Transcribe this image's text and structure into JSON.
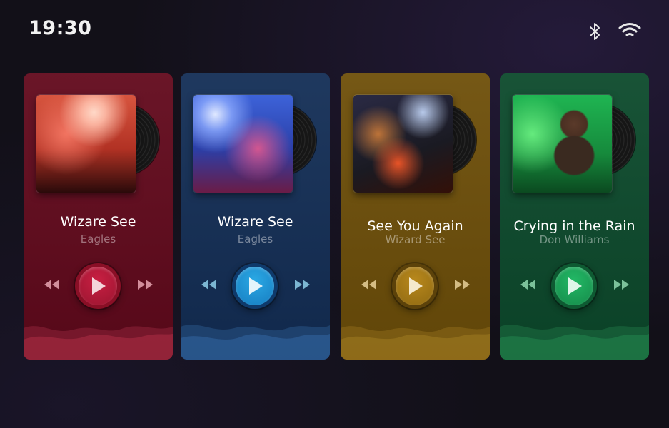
{
  "status": {
    "time": "19:30",
    "bluetooth_icon": "bluetooth-icon",
    "wifi_icon": "wifi-icon"
  },
  "cards": [
    {
      "title": "Wizare See",
      "artist": "Eagles",
      "accent": "#c81f42",
      "cover_icon": "concert-crowd-cover"
    },
    {
      "title": "Wizare See",
      "artist": "Eagles",
      "accent": "#2aa8e4",
      "cover_icon": "party-dancers-cover"
    },
    {
      "title": "See You Again",
      "artist": "Wizard See",
      "accent": "#b8881c",
      "cover_icon": "dj-mixer-cover"
    },
    {
      "title": "Crying in the Rain",
      "artist": "Don Williams",
      "accent": "#22b865",
      "cover_icon": "man-green-light-cover"
    }
  ],
  "controls": {
    "prev_icon": "rewind-icon",
    "play_icon": "play-icon",
    "next_icon": "fast-forward-icon"
  },
  "colors": {
    "red": "#62091c",
    "blue": "#132e56",
    "gold": "#6e4f09",
    "green": "#0c4a2c",
    "background": "#121018"
  }
}
